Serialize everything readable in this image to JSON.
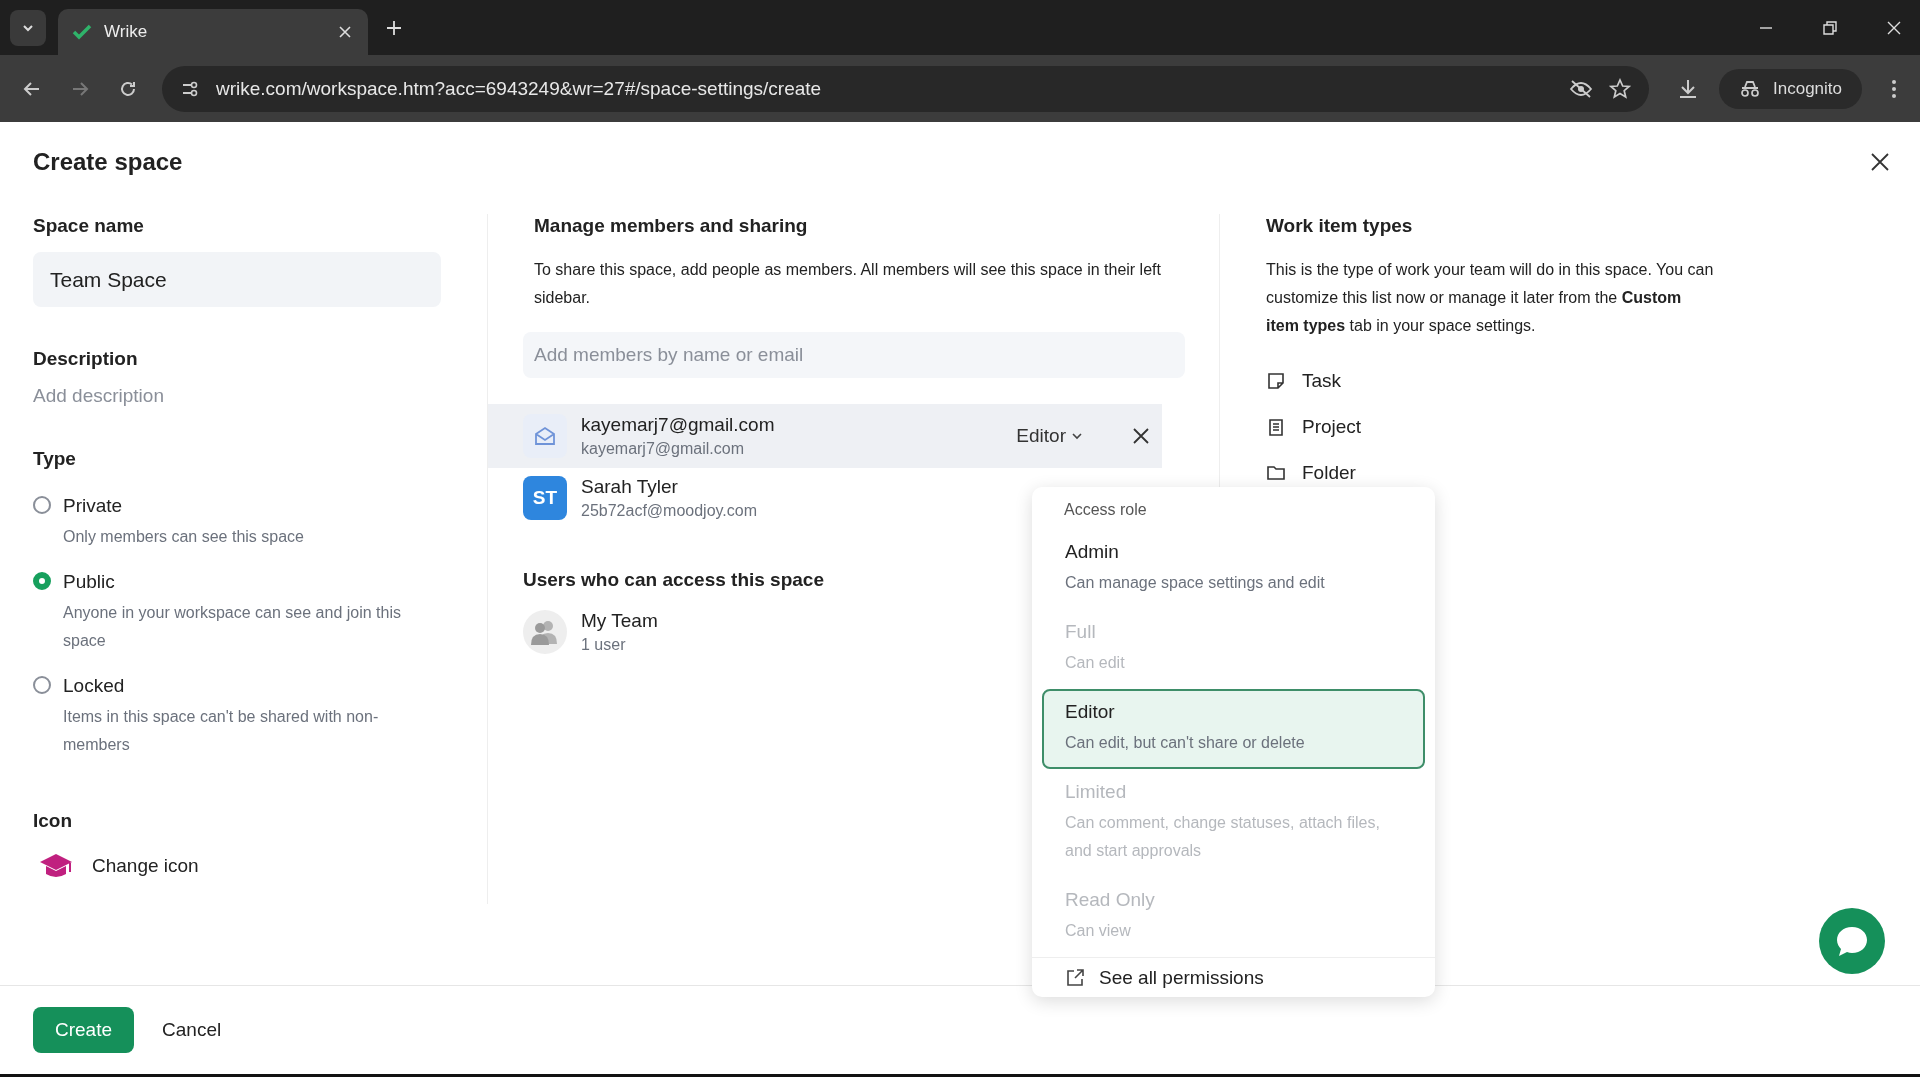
{
  "browser": {
    "tab": {
      "title": "Wrike"
    },
    "url": "wrike.com/workspace.htm?acc=6943249&wr=27#/space-settings/create",
    "profile": "Incognito"
  },
  "dialog": {
    "title": "Create space",
    "space_name": {
      "label": "Space name",
      "value": "Team Space"
    },
    "description": {
      "label": "Description",
      "placeholder": "Add description"
    },
    "type": {
      "label": "Type",
      "options": [
        {
          "label": "Private",
          "hint": "Only members can see this space",
          "selected": false
        },
        {
          "label": "Public",
          "hint": "Anyone in your workspace can see and join this space",
          "selected": true
        },
        {
          "label": "Locked",
          "hint": "Items in this space can't be shared with non-members",
          "selected": false
        }
      ]
    },
    "icon": {
      "label": "Icon",
      "action": "Change icon"
    }
  },
  "members": {
    "heading": "Manage members and sharing",
    "text": "To share this space, add people as members. All members will see this space in their left sidebar.",
    "add_field": {
      "placeholder": "Add members by name or email"
    },
    "list": [
      {
        "kind": "email",
        "name": "kayemarj7@gmail.com",
        "email": "kayemarj7@gmail.com",
        "role": "Editor",
        "hovered": true
      },
      {
        "kind": "user",
        "name": "Sarah Tyler",
        "email": "25b72acf@moodjoy.com",
        "initials": "ST",
        "hovered": false
      }
    ],
    "access_heading": "Users who can access this space",
    "groups": [
      {
        "name": "My Team",
        "count": "1 user"
      }
    ]
  },
  "work_item_types": {
    "heading": "Work item types",
    "text": "This is the type of work your team will do in this space. You can customize this list now or manage it later from the **Custom item types** tab in your space settings.",
    "items": [
      {
        "kind": "task",
        "label": "Task"
      },
      {
        "kind": "project",
        "label": "Project"
      },
      {
        "kind": "folder",
        "label": "Folder"
      }
    ]
  },
  "role_menu": {
    "heading": "Access role",
    "options": [
      {
        "name": "Admin",
        "hint": "Can manage space settings and edit",
        "selected": false,
        "disabled": false
      },
      {
        "name": "Full",
        "hint": "Can edit",
        "selected": false,
        "disabled": true
      },
      {
        "name": "Editor",
        "hint": "Can edit, but can't share or delete",
        "selected": true,
        "disabled": false
      },
      {
        "name": "Limited",
        "hint": "Can comment, change statuses, attach files, and start approvals",
        "selected": false,
        "disabled": true
      },
      {
        "name": "Read Only",
        "hint": "Can view",
        "selected": false,
        "disabled": true
      }
    ],
    "link": "See all permissions"
  },
  "footer": {
    "buttons": [
      {
        "kind": "primary",
        "label": "Create"
      },
      {
        "kind": "plain",
        "label": "Cancel"
      }
    ]
  }
}
